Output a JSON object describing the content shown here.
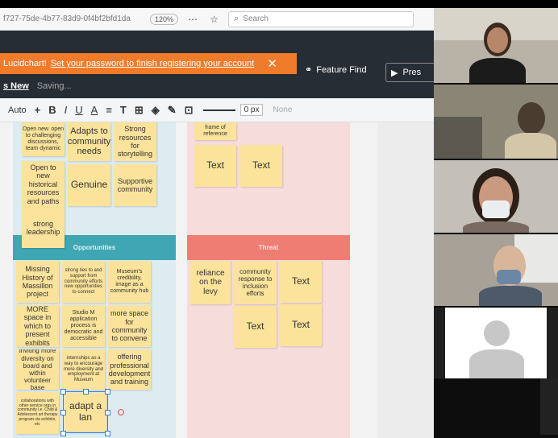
{
  "browser": {
    "url_fragment": "f727-75de-4b77-83d9-0f4bf2bfd1da",
    "zoom": "120%",
    "search_placeholder": "Search"
  },
  "banner": {
    "brand": "Lucidchart!",
    "link_text": "Set your password to finish registering your account",
    "close": "✕"
  },
  "subbar": {
    "whats_new": "s New",
    "status": "Saving..."
  },
  "header": {
    "feature_find": "Feature Find",
    "present": "Pres"
  },
  "toolbar": {
    "font_size": "Auto",
    "plus": "+",
    "bold": "B",
    "italic": "I",
    "underline": "U",
    "color": "A",
    "align": "≡",
    "text_tool": "T",
    "line_width": "0 px",
    "arrow": "None"
  },
  "board": {
    "opportunities_header": "Opportunities",
    "threats_header": "Threat",
    "notes": {
      "n1": "Open new. open to challenging discussions, team dynamic",
      "n2": "Adapts to community needs",
      "n3": "Strong resources for storytelling",
      "n4": "frame of reference",
      "n5": "Text",
      "n6": "Text",
      "n7": "Open to new historical resources and paths",
      "n8": "Genuine",
      "n9": "Supportive community",
      "n10": "strong leadership",
      "n11": "Missing History of Massillon project",
      "n12": "strong ties to and support from community efforts new opportunities to connect",
      "n13": "Museum's credibility, image as a community hub",
      "n14": "reliance on the levy",
      "n15": "community response to inclusion efforts",
      "n16": "Text",
      "n17": "MORE space in which to present exhibits",
      "n18": "Studio M application process is democratic and accessible",
      "n19": "more space for community to convene",
      "n20": "Text",
      "n21": "Text",
      "n22": "inviting more diversity on board and within volunteer base",
      "n23": "internships as a way to encourage more diversity and employment at Museum",
      "n24": "offering professional development and training",
      "n25": "collaborations with other service orgs in community i.e. Child & Adolescent art therapy program via exhibits, etc",
      "n26": "adapt a lan"
    }
  },
  "colors": {
    "sticky": "#fbe39b",
    "opportunities": "#3fa6b4",
    "threats": "#f07d73",
    "banner": "#f07b2a",
    "selection": "#3a7bd5"
  }
}
